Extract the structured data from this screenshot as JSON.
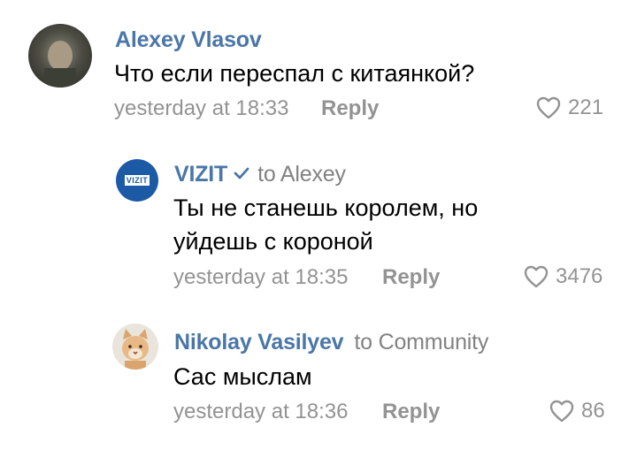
{
  "comments": [
    {
      "author": "Alexey Vlasov",
      "to": "",
      "text_lines": [
        "Что если переспал с китаянкой?"
      ],
      "time": "yesterday at 18:33",
      "reply_label": "Reply",
      "likes": "221"
    },
    {
      "author": "VIZIT",
      "avatar_text": "VIZIT",
      "to": "to Alexey",
      "text_lines": [
        "Ты не станешь королем, но",
        "уйдешь с короной"
      ],
      "time": "yesterday at 18:35",
      "reply_label": "Reply",
      "likes": "3476"
    },
    {
      "author": "Nikolay Vasilyev",
      "to": "to Community",
      "text_lines": [
        "Сас мыслам"
      ],
      "time": "yesterday at 18:36",
      "reply_label": "Reply",
      "likes": "86"
    }
  ],
  "colors": {
    "author": "#4a76a8",
    "meta": "#939393",
    "text": "#000000",
    "vizit_brand": "#1c5aa6"
  }
}
